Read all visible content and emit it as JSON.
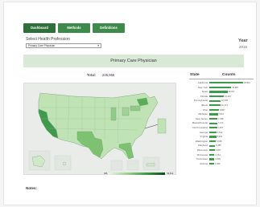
{
  "tabs": [
    {
      "label": "Dashboard"
    },
    {
      "label": "Methods"
    },
    {
      "label": "Definitions"
    }
  ],
  "filters": {
    "profession_label": "Select Health Profession",
    "profession_value": "Primary Care Physician",
    "year_label": "Year",
    "year_value": "2015"
  },
  "banner": {
    "title": "Primary Care Physician"
  },
  "total": {
    "label": "Total:",
    "value": "245,965"
  },
  "map": {
    "legend": {
      "min": "486",
      "max": "30,812"
    },
    "colors": {
      "light": "#e9f5e4",
      "mid": "#9bd18f",
      "dark": "#3f9a4a",
      "darkest": "#0f4d1e"
    }
  },
  "table": {
    "state_header": "State",
    "counts_header": "Counts",
    "bar_color": "#3f9d4c",
    "rows": [
      {
        "state": "California",
        "count": "30,812",
        "value": 30812
      },
      {
        "state": "New York",
        "count": "19,987",
        "value": 19987
      },
      {
        "state": "Texas",
        "count": "16,647",
        "value": 16647
      },
      {
        "state": "Florida",
        "count": "13,114",
        "value": 13114
      },
      {
        "state": "Pennsylvania",
        "count": "10,345",
        "value": 10345
      },
      {
        "state": "Illinois",
        "count": "10,171",
        "value": 10171
      },
      {
        "state": "Ohio",
        "count": "8,867",
        "value": 8867
      },
      {
        "state": "Michigan",
        "count": "7,811",
        "value": 7811
      },
      {
        "state": "New Jersey",
        "count": "7,338",
        "value": 7338
      },
      {
        "state": "Massachusetts",
        "count": "7,172",
        "value": 7172
      },
      {
        "state": "North Carolina",
        "count": "7,007",
        "value": 7007
      },
      {
        "state": "Georgia",
        "count": "6,512",
        "value": 6512
      },
      {
        "state": "Virginia",
        "count": "6,391",
        "value": 6391
      },
      {
        "state": "Washington",
        "count": "5,848",
        "value": 5848
      },
      {
        "state": "Maryland",
        "count": "5,286",
        "value": 5286
      },
      {
        "state": "Wisconsin",
        "count": "4,957",
        "value": 4957
      },
      {
        "state": "Minnesota",
        "count": "4,712",
        "value": 4712
      },
      {
        "state": "Tennessee",
        "count": "4,609",
        "value": 4609
      },
      {
        "state": "Arizona",
        "count": "4,356",
        "value": 4356
      }
    ]
  },
  "notes": {
    "label": "Notes:"
  }
}
